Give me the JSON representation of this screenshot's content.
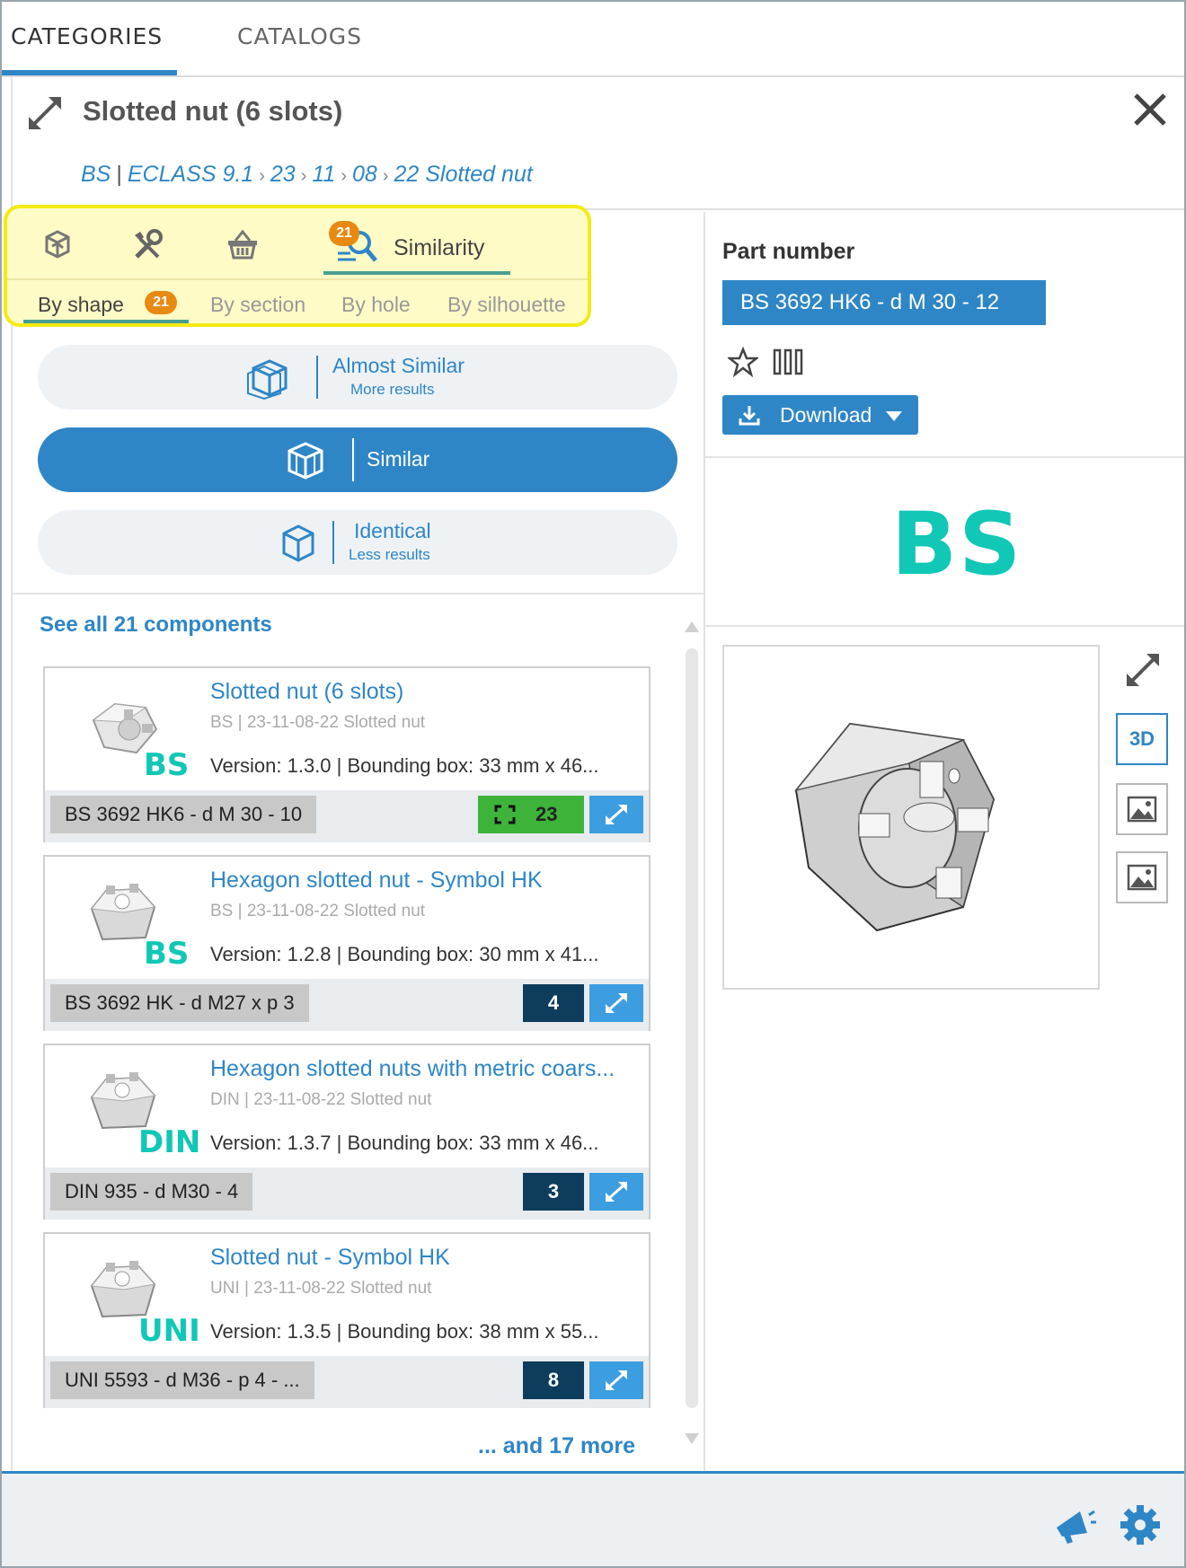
{
  "top_tabs": {
    "categories": "CATEGORIES",
    "catalogs": "CATALOGS"
  },
  "header": {
    "title": "Slotted nut (6 slots)",
    "breadcrumb": {
      "brand": "BS",
      "sep": "|",
      "items": [
        "ECLASS 9.1",
        "23",
        "11",
        "08",
        "22 Slotted nut"
      ],
      "chevron": "›"
    }
  },
  "tools": {
    "similarity_label": "Similarity",
    "similarity_badge": "21",
    "sub_tabs": {
      "by_shape": "By shape",
      "by_shape_badge": "21",
      "by_section": "By section",
      "by_hole": "By hole",
      "by_silhouette": "By silhouette"
    },
    "icons": [
      "3d-part-icon",
      "tools-icon",
      "basket-icon",
      "similarity-search-icon"
    ]
  },
  "similarity_levels": {
    "almost_similar": {
      "label": "Almost Similar",
      "sub": "More results"
    },
    "similar": {
      "label": "Similar"
    },
    "identical": {
      "label": "Identical",
      "sub": "Less results"
    }
  },
  "see_all": "See all 21 components",
  "results": [
    {
      "title": "Slotted nut (6 slots)",
      "category": "BS | 23-11-08-22 Slotted nut",
      "brand": "BS",
      "version": "Version: 1.3.0 | Bounding box: 33 mm x 46...",
      "part_number": "BS 3692 HK6 - d M 30 - 10",
      "count": "23",
      "count_style": "green"
    },
    {
      "title": "Hexagon slotted nut - Symbol HK",
      "category": "BS | 23-11-08-22 Slotted nut",
      "brand": "BS",
      "version": "Version: 1.2.8 | Bounding box: 30 mm x 41...",
      "part_number": "BS 3692 HK - d M27 x p 3",
      "count": "4",
      "count_style": "navy"
    },
    {
      "title": "Hexagon slotted nuts with metric coars...",
      "category": "DIN | 23-11-08-22 Slotted nut",
      "brand": "DIN",
      "version": "Version: 1.3.7 | Bounding box: 33 mm x 46...",
      "part_number": "DIN 935 - d M30 - 4",
      "count": "3",
      "count_style": "navy"
    },
    {
      "title": "Slotted nut - Symbol HK",
      "category": "UNI | 23-11-08-22 Slotted nut",
      "brand": "UNI",
      "version": "Version: 1.3.5 | Bounding box: 38 mm x 55...",
      "part_number": "UNI 5593 - d M36 - p 4 - ...",
      "count": "8",
      "count_style": "navy"
    }
  ],
  "more": "... and 17 more",
  "detail": {
    "part_number_label": "Part number",
    "part_number": "BS 3692 HK6 - d M 30 - 12",
    "download_label": "Download",
    "brand_logo": "BS",
    "viewer_3d_label": "3D"
  },
  "colors": {
    "accent": "#2f86c6",
    "brand_teal": "#11c7b6",
    "badge_orange": "#e88a11",
    "highlight_yellow": "#f4ea15",
    "count_navy": "#0d3c5c",
    "count_green": "#3eb33a"
  }
}
